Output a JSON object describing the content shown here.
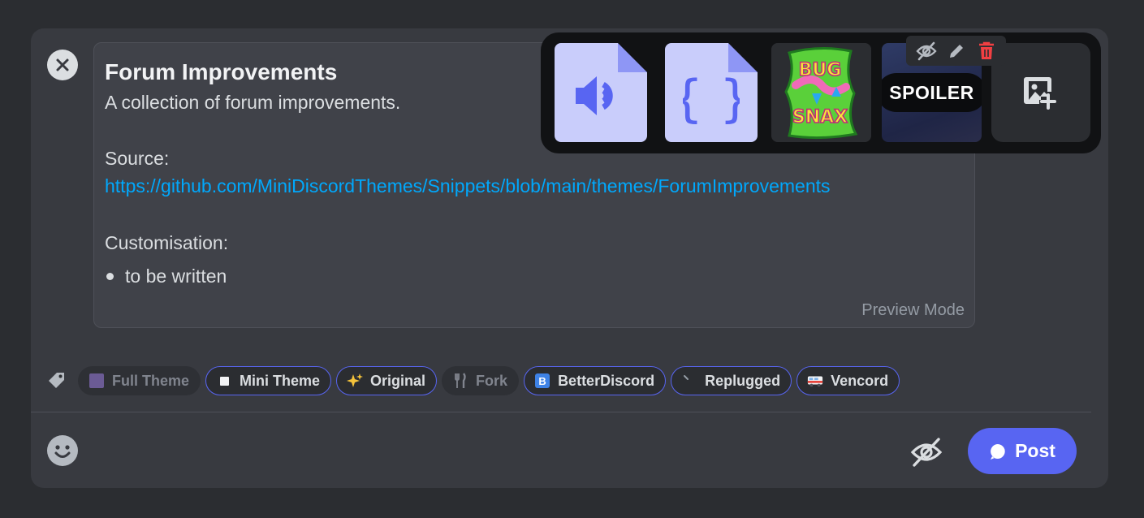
{
  "preview": {
    "title": "Forum Improvements",
    "description": "A collection of forum improvements.",
    "source_label": "Source:",
    "source_url": "https://github.com/MiniDiscordThemes/Snippets/blob/main/themes/ForumImprovements",
    "customisation_label": "Customisation:",
    "bullets": [
      "to be written"
    ],
    "mode_label": "Preview Mode"
  },
  "attachments": {
    "items": [
      {
        "kind": "file",
        "icon": "audio-file-icon"
      },
      {
        "kind": "file",
        "icon": "code-file-icon"
      },
      {
        "kind": "image",
        "icon": "bugsnax-image"
      },
      {
        "kind": "image",
        "spoiler_label": "SPOILER"
      }
    ],
    "add_icon": "add-image-icon",
    "tools": [
      "eye-slash-icon",
      "pencil-icon",
      "trash-icon"
    ]
  },
  "tags": [
    {
      "label": "Full Theme",
      "selected": false,
      "icon": "purple-square"
    },
    {
      "label": "Mini Theme",
      "selected": true,
      "icon": "white-square"
    },
    {
      "label": "Original",
      "selected": true,
      "icon": "sparkles"
    },
    {
      "label": "Fork",
      "selected": false,
      "icon": "fork-and-knife"
    },
    {
      "label": "BetterDiscord",
      "selected": true,
      "icon": "betterdiscord-logo"
    },
    {
      "label": "Replugged",
      "selected": true,
      "icon": "replugged-logo"
    },
    {
      "label": "Vencord",
      "selected": true,
      "icon": "vencord-bus"
    }
  ],
  "footer": {
    "post_label": "Post"
  },
  "colors": {
    "accent": "#5865f2",
    "link": "#00a8fc",
    "danger": "#f23f42",
    "background": "#2b2d31",
    "card": "#383a40"
  }
}
